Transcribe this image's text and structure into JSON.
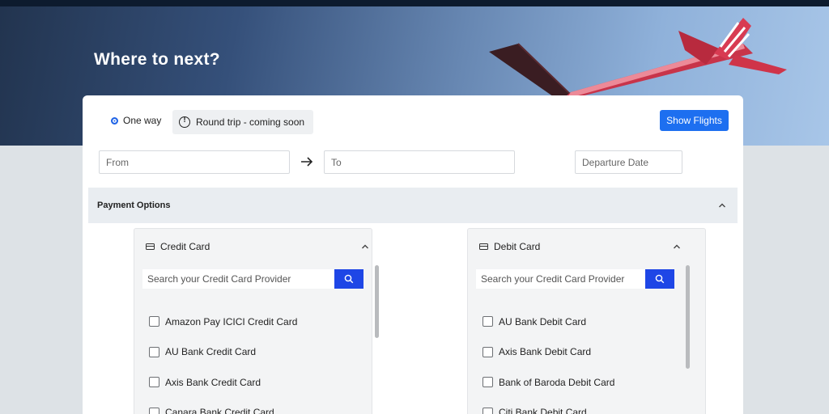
{
  "hero": {
    "title": "Where to next?"
  },
  "trip": {
    "one_way_label": "One way",
    "round_trip_label": "Round trip - coming soon",
    "show_flights_label": "Show Flights"
  },
  "search": {
    "from_placeholder": "From",
    "to_placeholder": "To",
    "date_placeholder": "Departure Date"
  },
  "payment": {
    "title": "Payment Options",
    "credit": {
      "title": "Credit Card",
      "search_placeholder": "Search your Credit Card Provider",
      "items": [
        "Amazon Pay ICICI Credit Card",
        "AU Bank Credit Card",
        "Axis Bank Credit Card",
        "Canara Bank Credit Card"
      ]
    },
    "debit": {
      "title": "Debit Card",
      "search_placeholder": "Search your Credit Card Provider",
      "items": [
        "AU Bank Debit Card",
        "Axis Bank Debit Card",
        "Bank of Baroda Debit Card",
        "Citi Bank Debit Card"
      ]
    }
  },
  "colors": {
    "accent": "#1d6ff0",
    "search_button": "#1e46e6",
    "hero_dark": "#22344f"
  },
  "icons": [
    "warning-circle-icon",
    "arrow-right-icon",
    "chevron-up-icon",
    "credit-card-icon",
    "search-icon"
  ]
}
